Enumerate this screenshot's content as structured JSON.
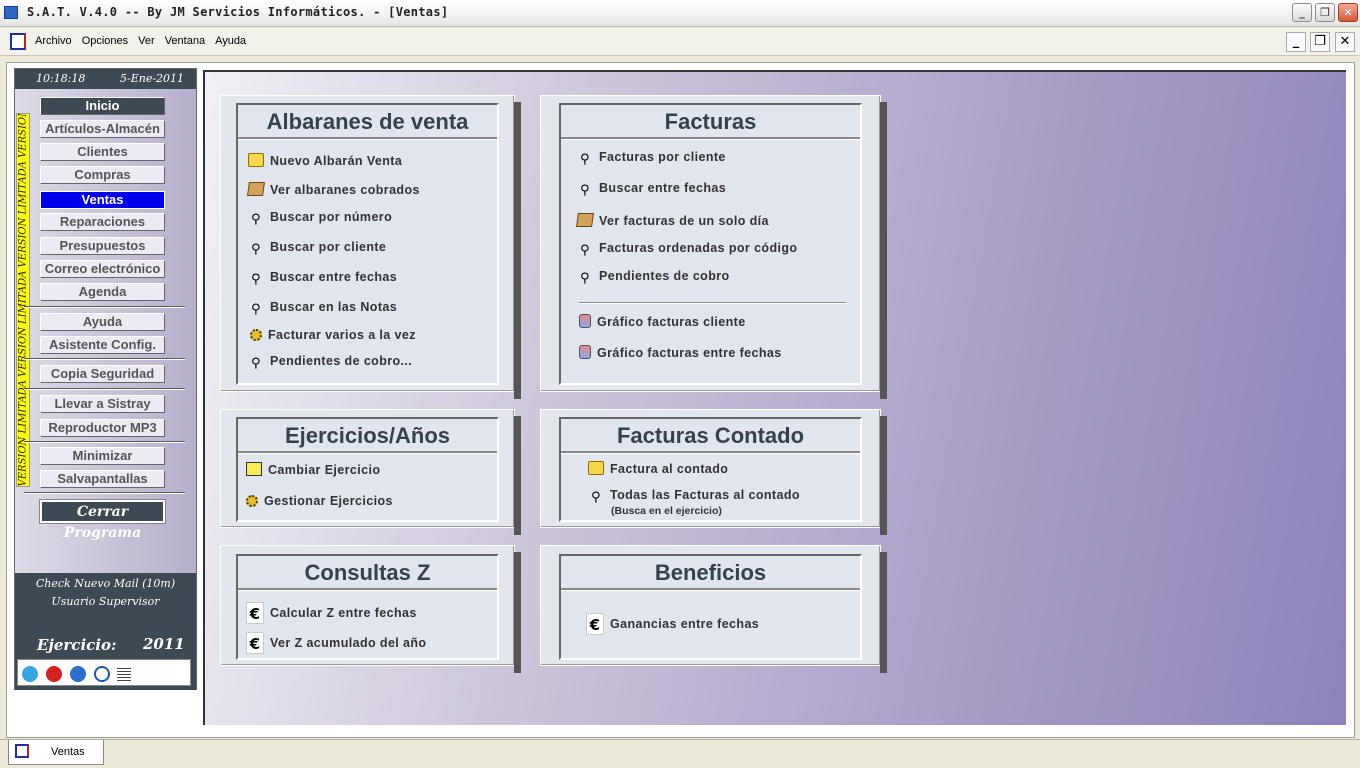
{
  "window": {
    "title": "S.A.T. V.4.0 -- By JM Servicios Informáticos. - [Ventas]"
  },
  "menu": [
    "Archivo",
    "Opciones",
    "Ver",
    "Ventana",
    "Ayuda"
  ],
  "sidebar": {
    "time": "10:18:18",
    "date": "5-Ene-2011",
    "ribbon": "VERSION LIMITADA  VERSION LIMITADA  VERSION LIMITADA  VERSION LIMITADA",
    "items": [
      "Inicio",
      "Artículos-Almacén",
      "Clientes",
      "Compras",
      "Ventas",
      "Reparaciones",
      "Presupuestos",
      "Correo electrónico",
      "Agenda",
      "Ayuda",
      "Asistente Config.",
      "Copia Seguridad",
      "Llevar a Sistray",
      "Reproductor MP3",
      "Minimizar",
      "Salvapantallas",
      "Cerrar Programa"
    ],
    "mail": "Check Nuevo Mail (10m)",
    "user": "Usuario Supervisor",
    "ejercicio_label": "Ejercicio:",
    "ejercicio_value": "2011",
    "tray_icons": [
      "users-icon",
      "alarm-icon",
      "globe-icon",
      "network-icon",
      "signal-icon"
    ]
  },
  "panels": {
    "albaranes": {
      "title": "Albaranes de venta",
      "links": [
        "Nuevo Albarán Venta",
        "Ver albaranes cobrados",
        "Buscar por número",
        "Buscar por cliente",
        "Buscar entre fechas",
        "Buscar en las Notas",
        "Facturar varios a la vez",
        "Pendientes de cobro..."
      ]
    },
    "facturas": {
      "title": "Facturas",
      "links": [
        "Facturas por cliente",
        "Buscar entre fechas",
        "Ver facturas de un solo día",
        "Facturas ordenadas por código",
        "Pendientes de cobro",
        "Gráfico facturas cliente",
        "Gráfico facturas entre fechas"
      ]
    },
    "ejercicios": {
      "title": "Ejercicios/Años",
      "links": [
        "Cambiar Ejercicio",
        "Gestionar Ejercicios"
      ]
    },
    "contado": {
      "title": "Facturas Contado",
      "links": [
        "Factura al contado",
        "Todas las Facturas al contado"
      ],
      "note": "(Busca en el ejercicio)"
    },
    "consultas": {
      "title": "Consultas  Z",
      "links": [
        "Calcular Z entre fechas",
        "Ver Z acumulado del año"
      ]
    },
    "beneficios": {
      "title": "Beneficios",
      "links": [
        "Ganancias entre fechas"
      ]
    }
  },
  "taskbar": {
    "tab": "Ventas"
  }
}
